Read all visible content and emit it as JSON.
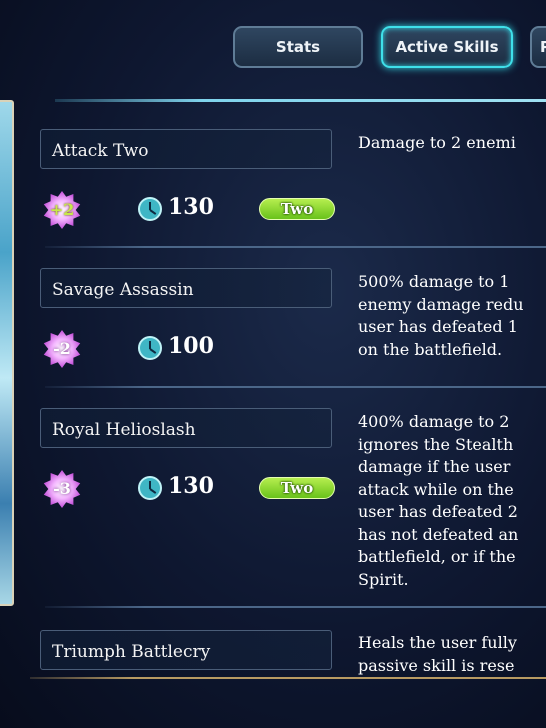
{
  "tabs": [
    {
      "label": "Stats"
    },
    {
      "label": "Active Skills"
    },
    {
      "label": "P"
    }
  ],
  "skills": [
    {
      "name": "Attack Two",
      "sp": "+2",
      "cooldown": "130",
      "target": "Two",
      "description": "Damage to 2 enemi"
    },
    {
      "name": "Savage Assassin",
      "sp": "-2",
      "cooldown": "100",
      "target": "",
      "description": "500% damage to 1\nenemy damage redu\nuser has defeated 1\non the battlefield."
    },
    {
      "name": "Royal Helioslash",
      "sp": "-3",
      "cooldown": "130",
      "target": "Two",
      "description": "400% damage to 2\nignores the Stealth\ndamage if the user\nattack while on the\nuser has defeated 2\nhas not defeated an\nbattlefield, or if the\nSpirit."
    },
    {
      "name": "Triumph Battlecry",
      "sp": "",
      "cooldown": "",
      "target": "",
      "description": "Heals the user fully\npassive skill is rese"
    }
  ],
  "icons": {
    "cooldown": "clock-icon",
    "sp": "sp-star-icon"
  },
  "colors": {
    "active_tab_glow": "#3fe0ea",
    "target_pill": "#7ad125",
    "sp_badge": "#c34fd9"
  }
}
